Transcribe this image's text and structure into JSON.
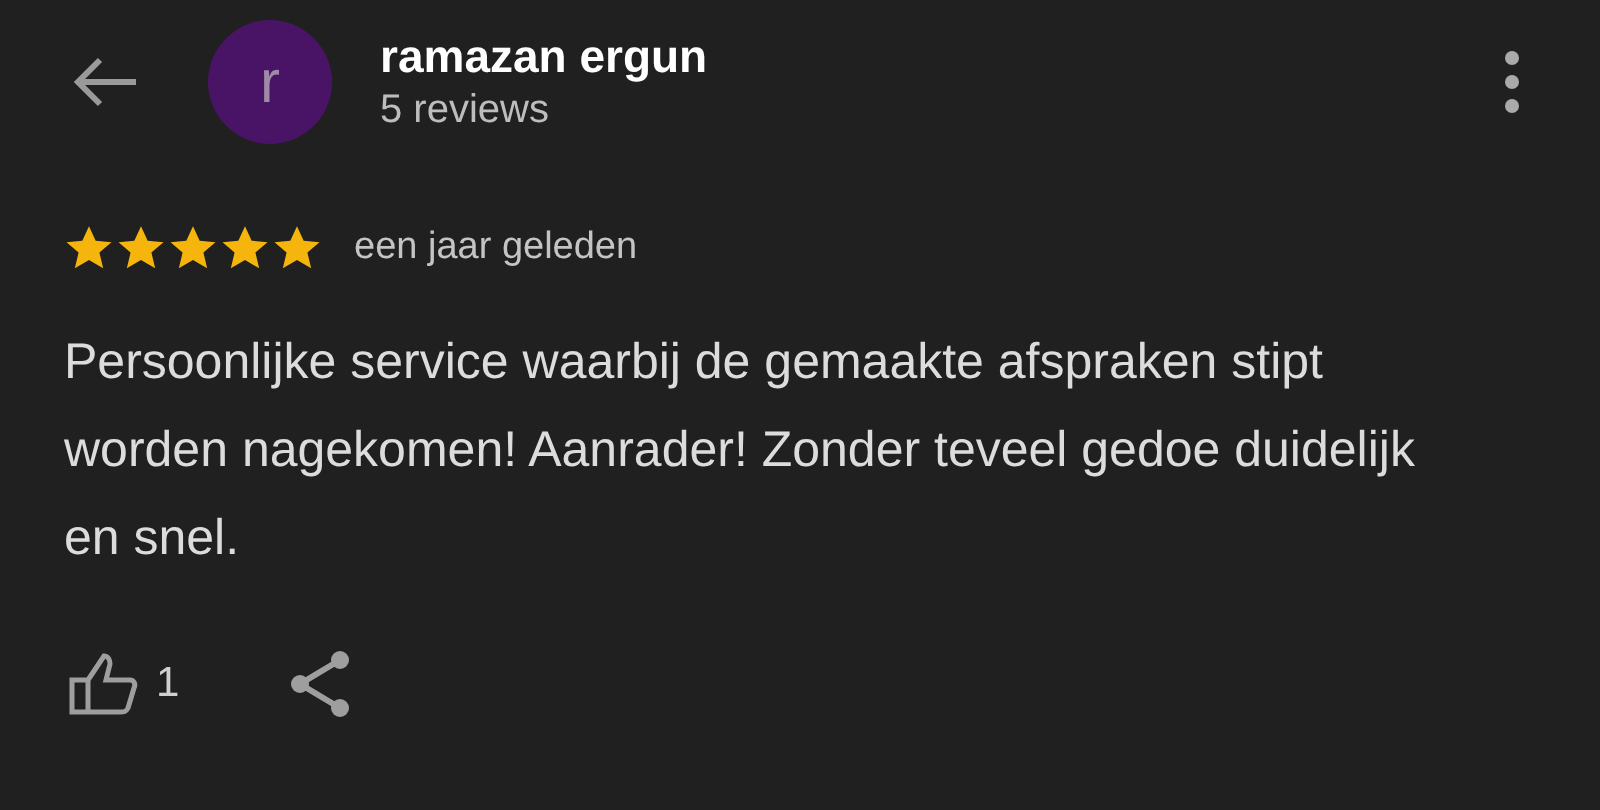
{
  "reviewer": {
    "initial": "r",
    "name": "ramazan ergun",
    "reviews": "5 reviews"
  },
  "review": {
    "stars": 5,
    "time": "een jaar geleden",
    "text": "Persoonlijke service waarbij de gemaakte afspraken stipt worden nagekomen! Aanrader! Zonder teveel gedoe duidelijk en snel."
  },
  "actions": {
    "likes": "1"
  }
}
